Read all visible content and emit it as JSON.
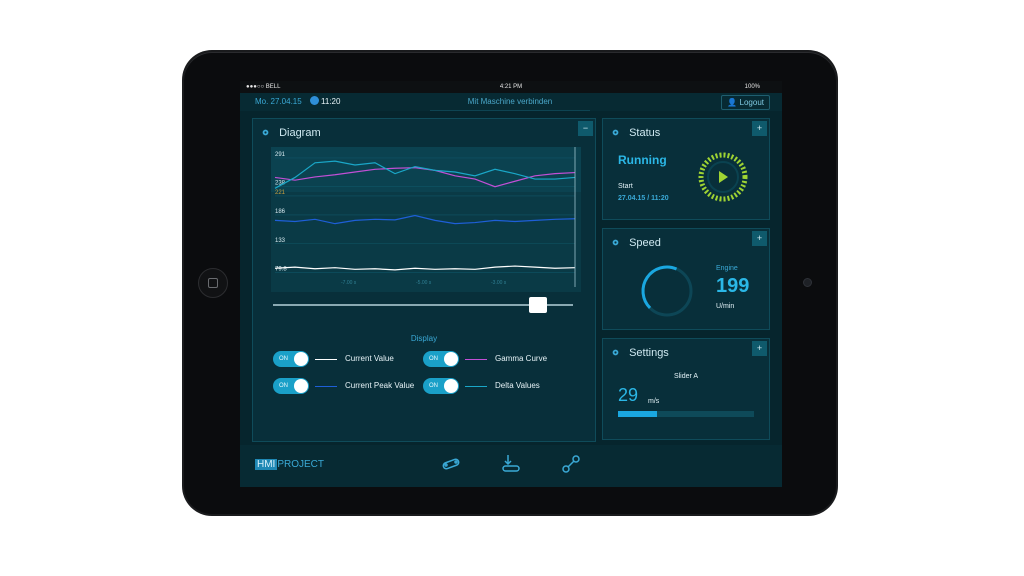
{
  "status_bar": {
    "carrier": "●●●○○ BELL",
    "time": "4:21 PM",
    "battery": "100%"
  },
  "top_bar": {
    "date": "Mo. 27.04.15",
    "time": "11:20",
    "connect": "Mit Maschine verbinden",
    "logout": "Logout"
  },
  "diagram": {
    "title": "Diagram",
    "collapse": "−",
    "display_title": "Display",
    "toggles": [
      {
        "label": "Current Value",
        "state": "ON",
        "color": "#ffffff"
      },
      {
        "label": "Gamma Curve",
        "state": "ON",
        "color": "#c24fd6"
      },
      {
        "label": "Current Peak Value",
        "state": "ON",
        "color": "#1e5fd8"
      },
      {
        "label": "Delta Values",
        "state": "ON",
        "color": "#1aa7c8"
      }
    ],
    "slider_position": 0.92
  },
  "chart_data": {
    "type": "line",
    "y_ticks": [
      "291",
      "238",
      "221",
      "186",
      "133",
      "79.8"
    ],
    "x_ticks": [
      "-7.00 s",
      "-5.00 s",
      "-3.00 s"
    ],
    "x": [
      0,
      1,
      2,
      3,
      4,
      5,
      6,
      7,
      8,
      9,
      10,
      11,
      12,
      13,
      14,
      15
    ],
    "series": [
      {
        "color": "#ffffff",
        "values": [
          88,
          90,
          87,
          89,
          86,
          87,
          85,
          88,
          86,
          87,
          86,
          90,
          92,
          90,
          88,
          89
        ]
      },
      {
        "color": "#1e5fd8",
        "values": [
          176,
          174,
          178,
          170,
          176,
          178,
          177,
          185,
          176,
          170,
          172,
          176,
          174,
          176,
          178,
          179
        ]
      },
      {
        "color": "#c24fd6",
        "values": [
          255,
          250,
          256,
          260,
          265,
          270,
          272,
          273,
          268,
          258,
          252,
          238,
          248,
          258,
          262,
          264
        ]
      },
      {
        "color": "#1aa7c8",
        "values": [
          235,
          255,
          282,
          285,
          278,
          282,
          262,
          275,
          268,
          265,
          258,
          270,
          262,
          252,
          252,
          255
        ]
      }
    ],
    "ylim": [
      70,
      300
    ]
  },
  "status": {
    "title": "Status",
    "state": "Running",
    "start_label": "Start",
    "start_value": "27.04.15 / 11:20",
    "expand": "+"
  },
  "speed": {
    "title": "Speed",
    "label": "Engine",
    "value": "199",
    "unit": "U/min",
    "gauge_fraction": 0.55,
    "expand": "+"
  },
  "settings": {
    "title": "Settings",
    "slider_label": "Slider A",
    "value": "29",
    "unit": "m/s",
    "slider_fraction": 0.29,
    "expand": "+"
  },
  "bottom": {
    "hmi": "HMI",
    "project": "PROJECT"
  }
}
